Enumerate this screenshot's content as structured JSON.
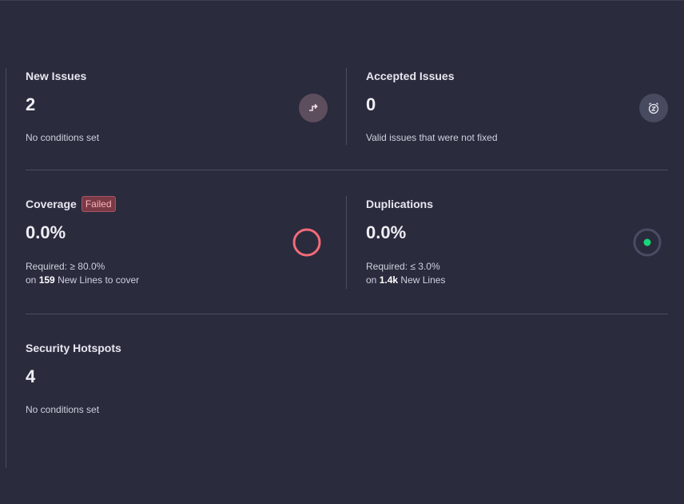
{
  "cards": {
    "new_issues": {
      "title": "New Issues",
      "value": "2",
      "desc": "No conditions set",
      "icon": "new-issues-arrow-icon"
    },
    "accepted_issues": {
      "title": "Accepted Issues",
      "value": "0",
      "desc": "Valid issues that were not fixed",
      "icon": "snooze-clock-icon"
    },
    "coverage": {
      "title": "Coverage",
      "badge": "Failed",
      "value": "0.0%",
      "required": "Required: ≥ 80.0%",
      "on": "on",
      "count": "159",
      "count_suffix": "New Lines to cover",
      "icon": "coverage-ring-icon",
      "status_color": "#f46b78"
    },
    "duplications": {
      "title": "Duplications",
      "value": "0.0%",
      "required": "Required: ≤ 3.0%",
      "on": "on",
      "count": "1.4k",
      "count_suffix": "New Lines",
      "icon": "duplications-ring-icon",
      "status_color": "#17d67a"
    },
    "security_hotspots": {
      "title": "Security Hotspots",
      "value": "4",
      "desc": "No conditions set"
    }
  }
}
